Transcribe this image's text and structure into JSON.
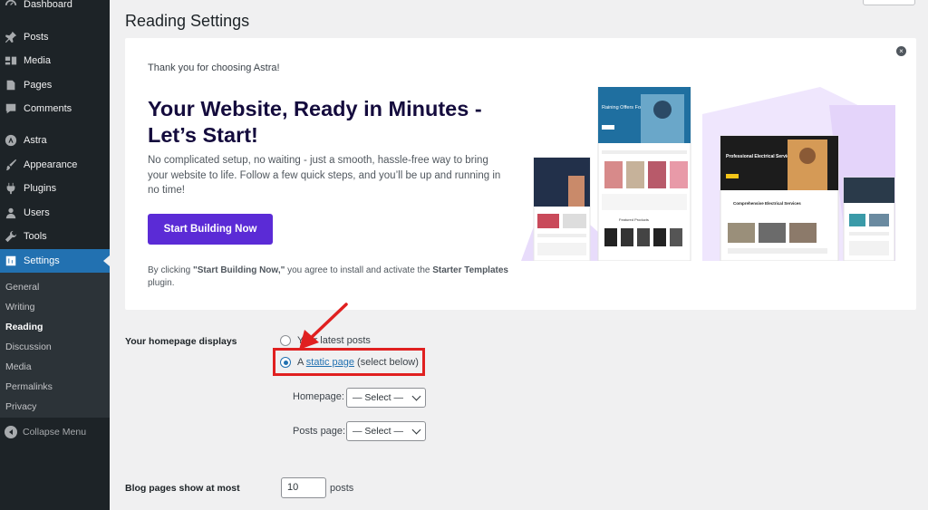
{
  "sidebar": {
    "items": [
      {
        "label": "Dashboard",
        "icon": "dashboard-icon"
      },
      {
        "label": "Posts",
        "icon": "pin-icon"
      },
      {
        "label": "Media",
        "icon": "media-icon"
      },
      {
        "label": "Pages",
        "icon": "pages-icon"
      },
      {
        "label": "Comments",
        "icon": "comment-icon"
      },
      {
        "label": "Astra",
        "icon": "astra-icon"
      },
      {
        "label": "Appearance",
        "icon": "brush-icon"
      },
      {
        "label": "Plugins",
        "icon": "plug-icon"
      },
      {
        "label": "Users",
        "icon": "user-icon"
      },
      {
        "label": "Tools",
        "icon": "wrench-icon"
      },
      {
        "label": "Settings",
        "icon": "settings-icon"
      }
    ],
    "submenu": [
      "General",
      "Writing",
      "Reading",
      "Discussion",
      "Media",
      "Permalinks",
      "Privacy"
    ],
    "collapse_label": "Collapse Menu"
  },
  "page": {
    "title": "Reading Settings"
  },
  "banner": {
    "thanks": "Thank you for choosing Astra!",
    "headline": "Your Website, Ready in Minutes - Let’s Start!",
    "description": "No complicated setup, no waiting - just a smooth, hassle-free way to bring your website to life. Follow a few quick steps, and you’ll be up and running in no time!",
    "button": "Start Building Now",
    "disclaimer_prefix": "By clicking ",
    "disclaimer_bold1": "\"Start Building Now,\"",
    "disclaimer_mid": " you agree to install and activate the ",
    "disclaimer_bold2": "Starter Templates",
    "disclaimer_suffix": " plugin.",
    "close_symbol": "×",
    "preview_texts": {
      "hero1": "Raining Offers For Hot Summer!",
      "hero2": "Professional Electrical Services",
      "section2": "Comprehensive Electrical Services",
      "featured": "Featured Products"
    }
  },
  "form": {
    "homepage_label": "Your homepage displays",
    "option_latest": "Your latest posts",
    "option_static_prefix": "A ",
    "option_static_link": "static page",
    "option_static_suffix": " (select below)",
    "homepage_select_label": "Homepage:",
    "homepage_select_value": "— Select —",
    "posts_select_label": "Posts page:",
    "posts_select_value": "— Select —",
    "blog_label": "Blog pages show at most",
    "blog_value": "10",
    "blog_unit": "posts"
  },
  "colors": {
    "sidebar_bg": "#1d2327",
    "accent": "#2271b1",
    "button_purple": "#5b2bd6",
    "annotation_red": "#e02020"
  }
}
